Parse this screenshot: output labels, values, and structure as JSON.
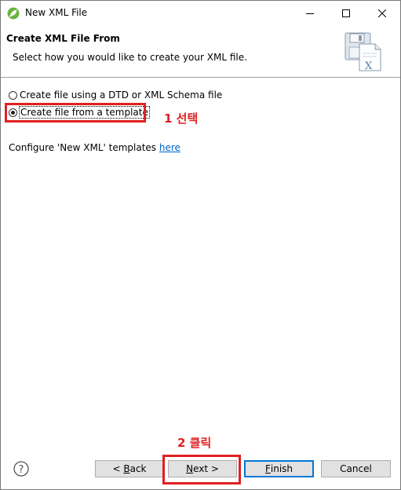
{
  "window": {
    "title": "New XML File"
  },
  "header": {
    "title": "Create XML File From",
    "description": "Select how you would like to create your XML file."
  },
  "options": [
    {
      "label": "Create file using a DTD or XML Schema file",
      "checked": false
    },
    {
      "label": "Create file from a template",
      "checked": true
    }
  ],
  "config": {
    "text": "Configure 'New XML' templates ",
    "link": "here"
  },
  "annotations": {
    "step1": "1 선택",
    "step2": "2 클릭"
  },
  "buttons": {
    "back_prefix": "< ",
    "back_mnemonic": "B",
    "back_rest": "ack",
    "next_mnemonic": "N",
    "next_rest": "ext >",
    "finish_mnemonic": "F",
    "finish_rest": "inish",
    "cancel": "Cancel"
  },
  "colors": {
    "annotation_red": "#e02020",
    "link_blue": "#0066cc",
    "default_button_border": "#0078d7"
  }
}
